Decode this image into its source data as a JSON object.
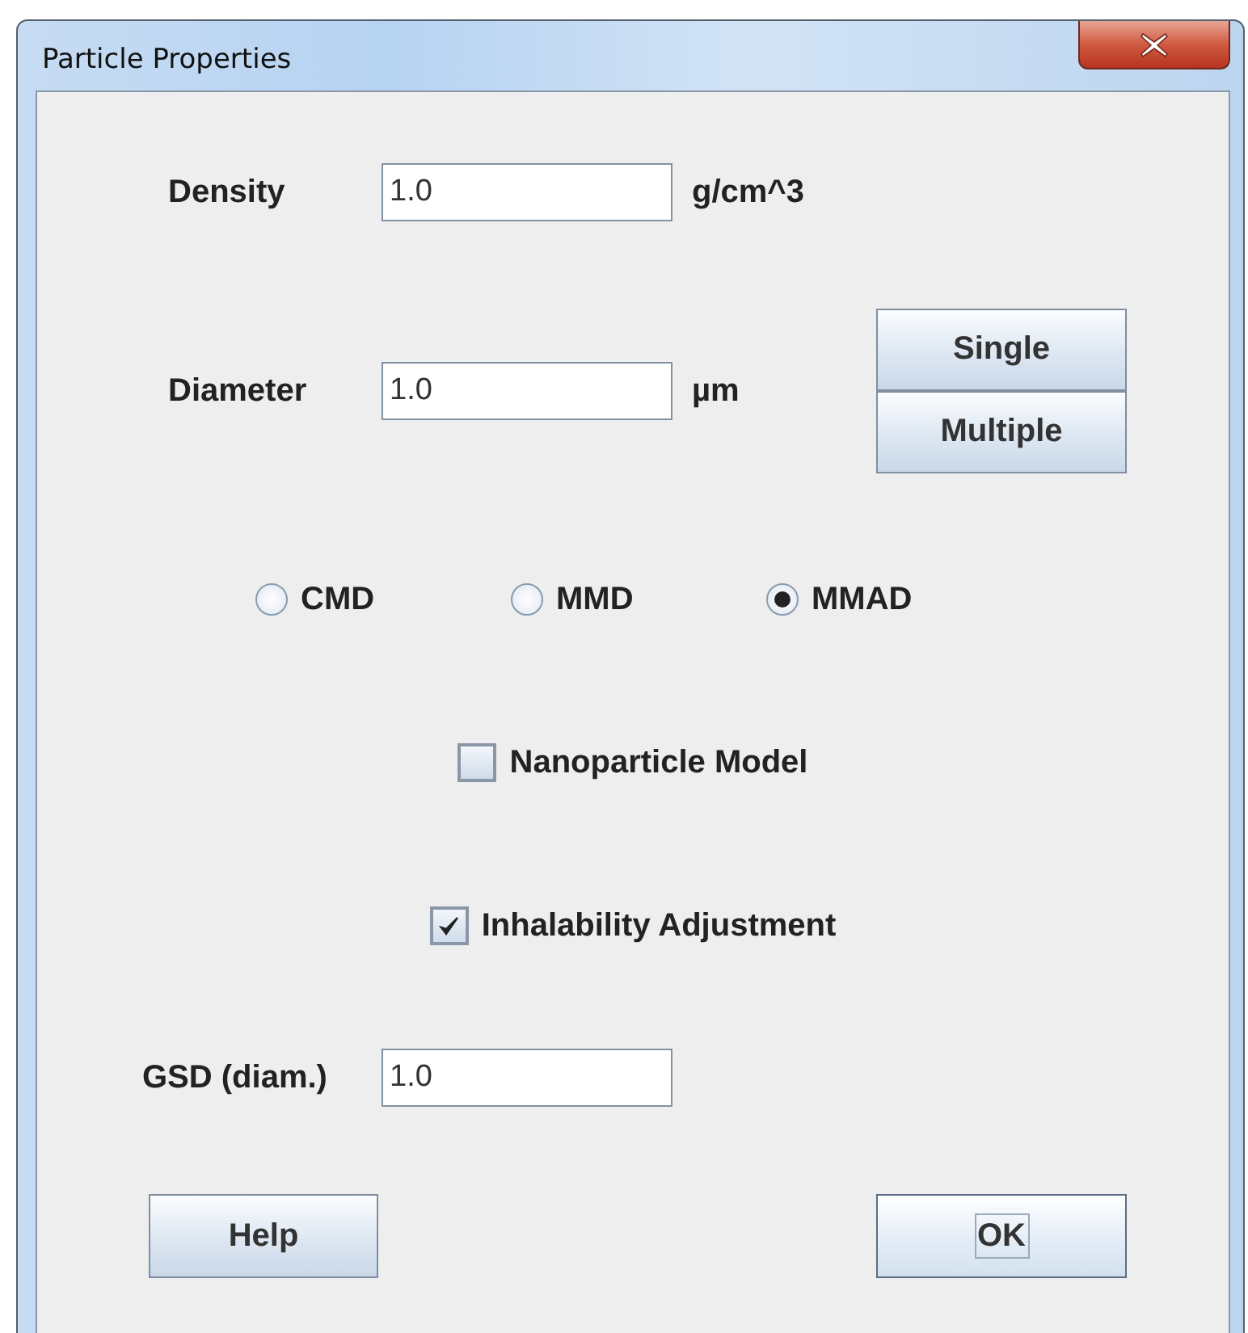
{
  "window": {
    "title": "Particle Properties"
  },
  "density": {
    "label": "Density",
    "value": "1.0",
    "unit": "g/cm^3"
  },
  "diameter": {
    "label": "Diameter",
    "value": "1.0",
    "unit": "µm"
  },
  "diameter_buttons": [
    "Single",
    "Multiple"
  ],
  "diameter_types": [
    {
      "label": "CMD",
      "selected": false
    },
    {
      "label": "MMD",
      "selected": false
    },
    {
      "label": "MMAD",
      "selected": true
    }
  ],
  "options": [
    {
      "label": "Nanoparticle Model",
      "checked": false
    },
    {
      "label": "Inhalability Adjustment",
      "checked": true
    }
  ],
  "gsd": {
    "label": "GSD (diam.)",
    "value": "1.0"
  },
  "buttons": [
    {
      "label": "Help",
      "focused": false
    },
    {
      "label": "OK",
      "focused": true
    }
  ]
}
